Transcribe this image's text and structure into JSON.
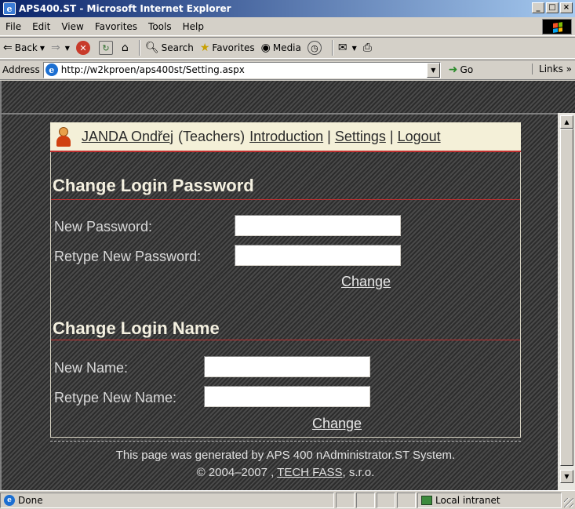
{
  "window": {
    "title": "APS400.ST - Microsoft Internet Explorer",
    "buttons": [
      "_",
      "□",
      "×"
    ]
  },
  "menu": [
    "File",
    "Edit",
    "View",
    "Favorites",
    "Tools",
    "Help"
  ],
  "toolbar": {
    "back": "Back",
    "search": "Search",
    "favorites": "Favorites",
    "media": "Media"
  },
  "address": {
    "label": "Address",
    "url": "http://w2kproen/aps400st/Setting.aspx",
    "go": "Go",
    "links": "Links »"
  },
  "userbar": {
    "user": "JANDA Ondřej",
    "role": "(Teachers)",
    "introduction": "Introduction",
    "sep": "|",
    "settings": "Settings",
    "logout": "Logout"
  },
  "password_section": {
    "title": "Change Login Password",
    "new_label": "New Password:",
    "retype_label": "Retype New Password:",
    "change": "Change"
  },
  "name_section": {
    "title": "Change Login Name",
    "new_label": "New Name:",
    "retype_label": "Retype New Name:",
    "change": "Change"
  },
  "footer": {
    "line1": "This page was generated by APS 400 nAdministrator.ST System.",
    "copyright": "© 2004–2007 ,",
    "company": "TECH FASS",
    "suffix": ", s.r.o."
  },
  "status": {
    "text": "Done",
    "zone": "Local intranet"
  }
}
